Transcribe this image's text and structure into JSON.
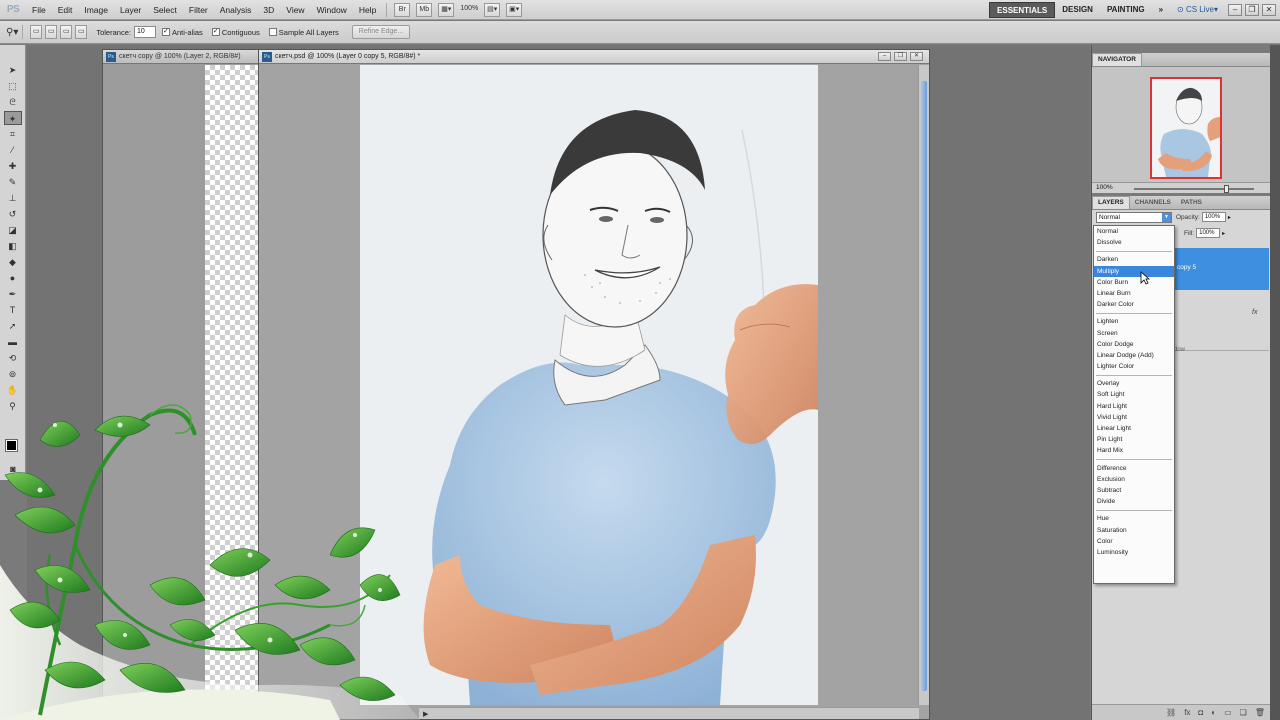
{
  "app": {
    "logo": "PS"
  },
  "menu": [
    "File",
    "Edit",
    "Image",
    "Layer",
    "Select",
    "Filter",
    "Analysis",
    "3D",
    "View",
    "Window",
    "Help"
  ],
  "menubar_buttons": {
    "br": "Br",
    "mb": "Mb",
    "zoom": "100%"
  },
  "workspaces": [
    "ESSENTIALS",
    "DESIGN",
    "PAINTING"
  ],
  "workspace_more": "»",
  "cs_live": "CS Live",
  "options": {
    "tolerance_label": "Tolerance:",
    "tolerance_value": "10",
    "antialias_label": "Anti-alias",
    "contiguous_label": "Contiguous",
    "sample_all_label": "Sample All Layers",
    "refine_edge_label": "Refine Edge..."
  },
  "documents": [
    {
      "title": "скетч copy @ 100% (Layer 2, RGB/8#)"
    },
    {
      "title": "скетч.psd @ 100% (Layer 0 copy 5, RGB/8#) *"
    }
  ],
  "navigator": {
    "tab": "NAVIGATOR",
    "zoom": "100%"
  },
  "layers": {
    "tabs": [
      "LAYERS",
      "CHANNELS",
      "PATHS"
    ],
    "blend_mode": "Normal",
    "opacity_label": "Opacity:",
    "opacity_value": "100%",
    "fill_label": "Fill:",
    "fill_value": "100%",
    "selected_layer": "copy 5",
    "partial_label": "dow"
  },
  "blend_modes": {
    "groups": [
      [
        "Normal",
        "Dissolve"
      ],
      [
        "Darken",
        "Multiply",
        "Color Burn",
        "Linear Burn",
        "Darker Color"
      ],
      [
        "Lighten",
        "Screen",
        "Color Dodge",
        "Linear Dodge (Add)",
        "Lighter Color"
      ],
      [
        "Overlay",
        "Soft Light",
        "Hard Light",
        "Vivid Light",
        "Linear Light",
        "Pin Light",
        "Hard Mix"
      ],
      [
        "Difference",
        "Exclusion",
        "Subtract",
        "Divide"
      ],
      [
        "Hue",
        "Saturation",
        "Color",
        "Luminosity"
      ]
    ],
    "highlighted": "Multiply"
  },
  "colors": {
    "accent": "#3a86dc",
    "shirt": "#a9c6e2",
    "skin": "#e7a37d",
    "leaf": "#3aa12e"
  }
}
